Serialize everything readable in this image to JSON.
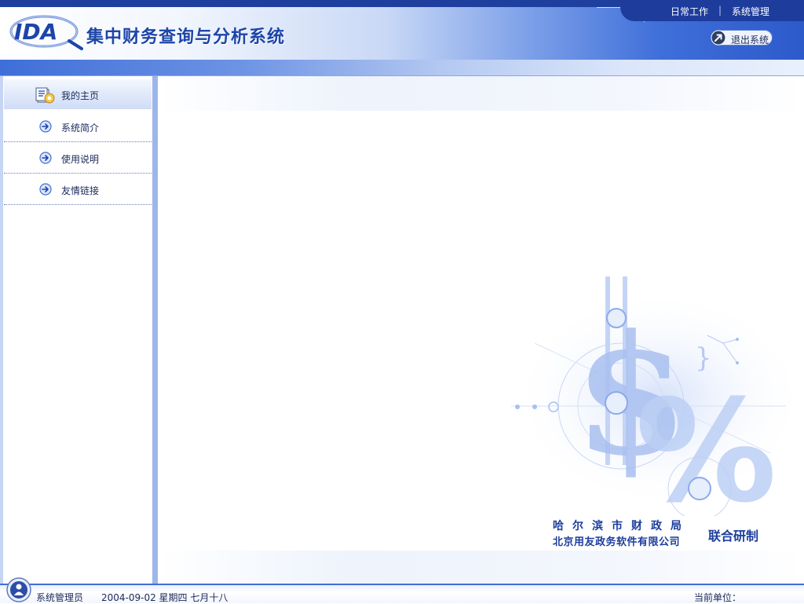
{
  "header": {
    "logo_text": "IDA",
    "title": "集中财务查询与分析系统",
    "menu": {
      "daily_work": "日常工作",
      "separator": "|",
      "system_management": "系统管理"
    },
    "logout_label": "退出系统"
  },
  "sidebar": {
    "items": [
      {
        "label": "我的主页",
        "icon": "home-page-icon",
        "active": true
      },
      {
        "label": "系统简介",
        "icon": "arrow-right-circle-icon"
      },
      {
        "label": "使用说明",
        "icon": "arrow-right-circle-icon"
      },
      {
        "label": "友情链接",
        "icon": "arrow-right-circle-icon"
      }
    ]
  },
  "content": {
    "credits": {
      "line1": "哈尔滨市财政局",
      "line2": "北京用友政务软件有限公司",
      "joint": "联合研制"
    }
  },
  "statusbar": {
    "user": "系统管理员",
    "date": "2004-09-02 星期四 七月十八",
    "unit_label": "当前单位："
  },
  "colors": {
    "brand_blue": "#1c45a8",
    "header_dark": "#1f3f9e",
    "accent": "#3f6fd9"
  }
}
